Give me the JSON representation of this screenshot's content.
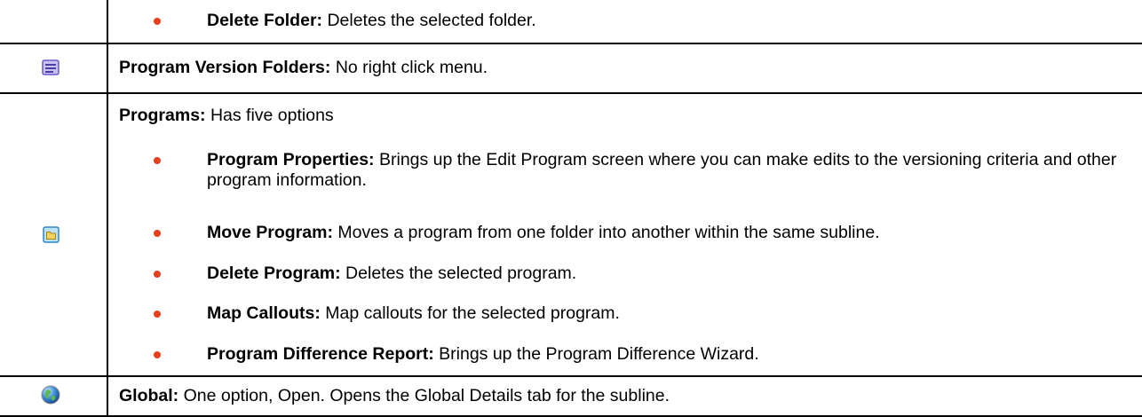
{
  "rows": {
    "delete_folder": {
      "term": "Delete Folder:",
      "desc": " Deletes the selected folder."
    },
    "program_version_folders": {
      "icon": "list-folder-icon",
      "term": "Program Version Folders:",
      "desc": " No right click menu."
    },
    "programs": {
      "icon": "program-folder-icon",
      "term": "Programs:",
      "desc": " Has five options",
      "items": [
        {
          "term": "Program Properties:",
          "desc": " Brings up the Edit Program screen where you can make edits to the versioning criteria and other program information."
        },
        {
          "term": "Move Program:",
          "desc": " Moves a program from one folder into another within the same subline."
        },
        {
          "term": "Delete Program:",
          "desc": " Deletes the selected program."
        },
        {
          "term": "Map Callouts:",
          "desc": " Map callouts for the selected program."
        },
        {
          "term": "Program Difference Report:",
          "desc": " Brings up the Program Difference Wizard."
        }
      ]
    },
    "global": {
      "icon": "globe-icon",
      "term": "Global:",
      "desc": " One option, Open. Opens the Global Details tab for the subline."
    }
  },
  "colors": {
    "bullet": "#e8401c",
    "rule": "#000000"
  }
}
